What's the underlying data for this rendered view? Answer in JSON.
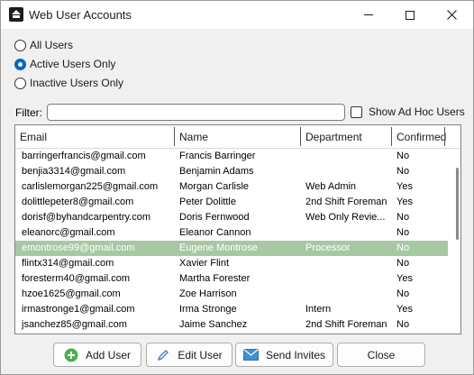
{
  "window": {
    "title": "Web User Accounts"
  },
  "filters": {
    "all_users": "All Users",
    "active_only": "Active Users Only",
    "inactive_only": "Inactive Users Only",
    "selected": "active_only"
  },
  "filter": {
    "label": "Filter:",
    "value": "",
    "adhoc_label": "Show Ad Hoc Users",
    "adhoc_checked": false
  },
  "grid": {
    "columns": {
      "email": "Email",
      "name": "Name",
      "department": "Department",
      "confirmed": "Confirmed"
    },
    "selected_index": 6,
    "rows": [
      {
        "email": "barringerfrancis@gmail.com",
        "name": "Francis Barringer",
        "department": "",
        "confirmed": "No"
      },
      {
        "email": "benjia3314@gmail.com",
        "name": "Benjamin Adams",
        "department": "",
        "confirmed": "No"
      },
      {
        "email": "carlislemorgan225@gmail.com",
        "name": "Morgan Carlisle",
        "department": "Web Admin",
        "confirmed": "Yes"
      },
      {
        "email": "dolittlepeter8@gmail.com",
        "name": "Peter Dolittle",
        "department": "2nd Shift Foreman",
        "confirmed": "Yes"
      },
      {
        "email": "dorisf@byhandcarpentry.com",
        "name": "Doris Fernwood",
        "department": "Web Only Revie...",
        "confirmed": "No"
      },
      {
        "email": "eleanorc@gmail.com",
        "name": "Eleanor Cannon",
        "department": "",
        "confirmed": "No"
      },
      {
        "email": "emontrose99@gmail.com",
        "name": "Eugene Montrose",
        "department": "Processor",
        "confirmed": "No"
      },
      {
        "email": "flintx314@gmail.com",
        "name": "Xavier Flint",
        "department": "",
        "confirmed": "No"
      },
      {
        "email": "foresterm40@gmail.com",
        "name": "Martha Forester",
        "department": "",
        "confirmed": "Yes"
      },
      {
        "email": "hzoe1625@gmail.com",
        "name": "Zoe Harrison",
        "department": "",
        "confirmed": "No"
      },
      {
        "email": "irmastronge1@gmail.com",
        "name": "Irma Stronge",
        "department": "Intern",
        "confirmed": "Yes"
      },
      {
        "email": "jsanchez85@gmail.com",
        "name": "Jaime Sanchez",
        "department": "2nd Shift Foreman",
        "confirmed": "No"
      }
    ]
  },
  "buttons": {
    "add": "Add User",
    "edit": "Edit User",
    "send": "Send Invites",
    "close": "Close"
  },
  "colors": {
    "selection": "#a6c9a4",
    "accent": "#0067c0",
    "add_icon": "#4caf50",
    "send_icon": "#3f8fd2"
  }
}
